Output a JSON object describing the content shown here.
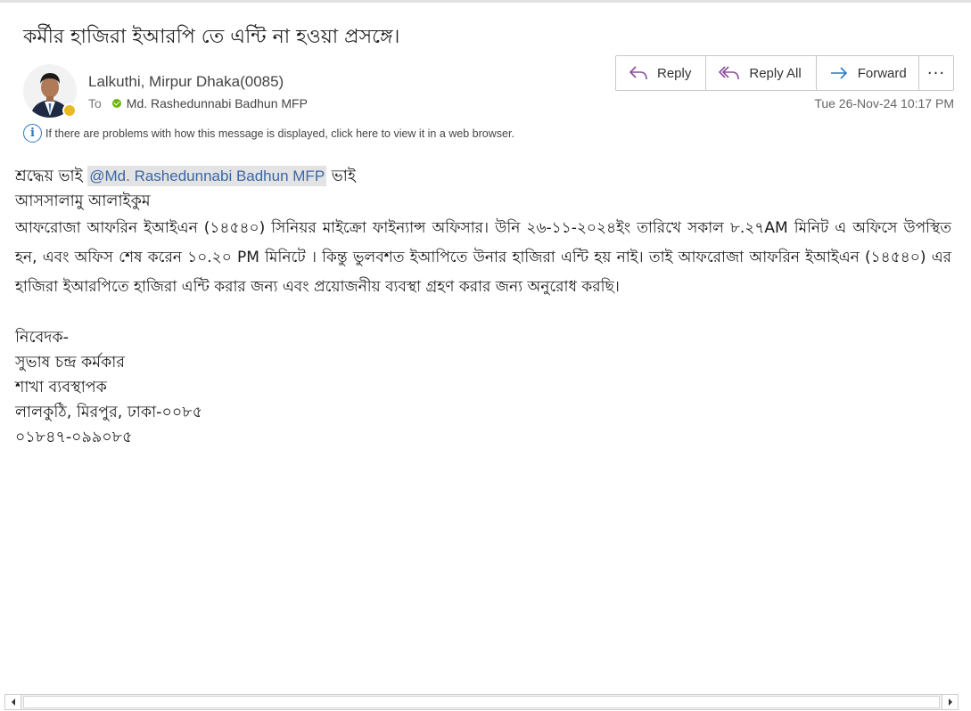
{
  "subject": "কর্মীর হাজিরা ইআরপি তে  এন্টি না হওয়া প্রসঙ্গে।",
  "sender": {
    "name": "Lalkuthi, Mirpur Dhaka(0085)",
    "to_label": "To",
    "recipient": "Md. Rashedunnabi Badhun MFP",
    "timestamp": "Tue 26-Nov-24 10:17 PM",
    "presence_color": "#e8b922",
    "recipient_status_color": "#6bb700"
  },
  "actions": {
    "reply": "Reply",
    "reply_all": "Reply All",
    "forward": "Forward",
    "more": "···"
  },
  "infobar": {
    "icon": "i",
    "text": "If there are problems with how this message is displayed, click here to view it in a web browser."
  },
  "body": {
    "greeting_prefix": "শ্রদ্ধেয় ভাই ",
    "mention": "@Md. Rashedunnabi Badhun MFP",
    "greeting_suffix": " ভাই",
    "salam": "আসসালামু আলাইকুম",
    "paragraph": "আফরোজা আফরিন ইআইএন (১৪৫৪০) সিনিয়র মাইক্রো ফাইন্যান্স অফিসার। উনি ২৬-১১-২০২৪ইং তারিখে সকাল ৮.২৭AM মিনিট এ অফিসে উপস্থিত হন, এবং অফিস শেষ করেন ১০.২০ PM মিনিটে  । কিন্তু ভুলবশত ইআপিতে  উনার হাজিরা এন্টি হয় নাই। তাই আফরোজা আফরিন ইআইএন (১৪৫৪০) এর হাজিরা ইআরপিতে হাজিরা  এন্টি করার জন্য এবং প্রয়োজনীয় ব্যবস্থা গ্রহণ করার জন্য অনুরোধ করছি।",
    "signature": [
      "নিবেদক-",
      "সুভাষ চন্দ্র কর্মকার",
      "শাখা ব্যবস্থাপক",
      "লালকুঠি, মিরপুর, ঢাকা-০০৮৫",
      "০১৮৪৭-০৯৯০৮৫"
    ]
  }
}
